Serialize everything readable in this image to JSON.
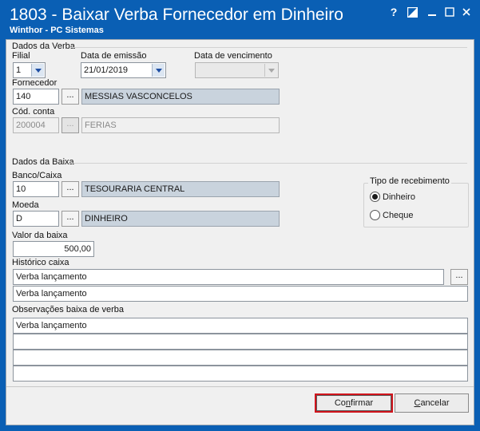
{
  "window": {
    "title": "1803 - Baixar Verba Fornecedor em Dinheiro",
    "subtitle": "Winthor - PC Sistemas",
    "help_glyph": "?"
  },
  "verba": {
    "section_label": "Dados da Verba",
    "filial_label": "Filial",
    "filial_value": "1",
    "emissao_label": "Data de emissão",
    "emissao_value": "21/01/2019",
    "vencimento_label": "Data de vencimento",
    "vencimento_value": "",
    "fornecedor_label": "Fornecedor",
    "fornecedor_code": "140",
    "fornecedor_name": "MESSIAS VASCONCELOS",
    "conta_label": "Cód. conta",
    "conta_code": "200004",
    "conta_name": "FERIAS",
    "dots": "..."
  },
  "baixa": {
    "section_label": "Dados da Baixa",
    "banco_label": "Banco/Caixa",
    "banco_code": "10",
    "banco_name": "TESOURARIA CENTRAL",
    "moeda_label": "Moeda",
    "moeda_code": "D",
    "moeda_name": "DINHEIRO",
    "valor_label": "Valor da baixa",
    "valor_value": "500,00",
    "historico_label": "Histórico caixa",
    "historico_line1": "Verba lançamento",
    "historico_line2": "Verba lançamento",
    "observacoes_label": "Observações baixa de verba",
    "observacoes_lines": [
      "Verba lançamento",
      "",
      "",
      ""
    ]
  },
  "recebimento": {
    "group_label": "Tipo de recebimento",
    "options": [
      "Dinheiro",
      "Cheque"
    ],
    "selected": "Dinheiro"
  },
  "footer": {
    "confirm_prefix": "Co",
    "confirm_key": "n",
    "confirm_suffix": "firmar",
    "cancel_key": "C",
    "cancel_suffix": "ancelar"
  },
  "colors": {
    "titlebar": "#0a5fb4",
    "readonly_field": "#c9d3dd",
    "confirm_highlight": "#d0141c"
  }
}
